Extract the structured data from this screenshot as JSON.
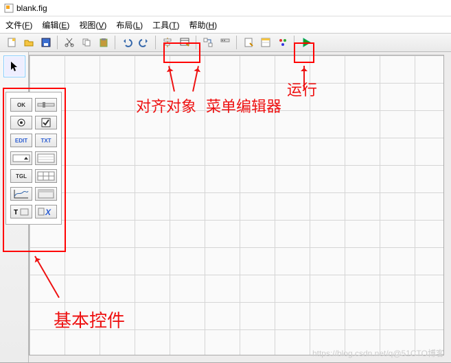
{
  "window": {
    "title": "blank.fig"
  },
  "menu": {
    "items": [
      {
        "label": "文件",
        "key": "F"
      },
      {
        "label": "编辑",
        "key": "E"
      },
      {
        "label": "视图",
        "key": "V"
      },
      {
        "label": "布局",
        "key": "L"
      },
      {
        "label": "工具",
        "key": "T"
      },
      {
        "label": "帮助",
        "key": "H"
      }
    ]
  },
  "toolbar": {
    "buttons": [
      "new-icon",
      "open-icon",
      "save-icon",
      "",
      "cut-icon",
      "copy-icon",
      "paste-icon",
      "",
      "undo-icon",
      "redo-icon",
      "",
      "align-objects-icon",
      "menu-editor-icon",
      "",
      "tab-order-icon",
      "toolbar-editor-icon",
      "",
      "mfile-editor-icon",
      "property-inspector-icon",
      "object-browser-icon",
      "",
      "run-icon"
    ]
  },
  "palette": {
    "controls": [
      "OK",
      "slider",
      "radio",
      "check",
      "EDIT",
      "TXT",
      "popup",
      "list",
      "TGL",
      "table",
      "axes",
      "panel",
      "T-ctrl",
      "X-ctrl"
    ]
  },
  "annotations": {
    "align": "对齐对象",
    "menu_editor": "菜单编辑器",
    "run": "运行",
    "basic_controls": "基本控件"
  },
  "watermark": "https://blog.csdn.net/q@51CTO博客"
}
